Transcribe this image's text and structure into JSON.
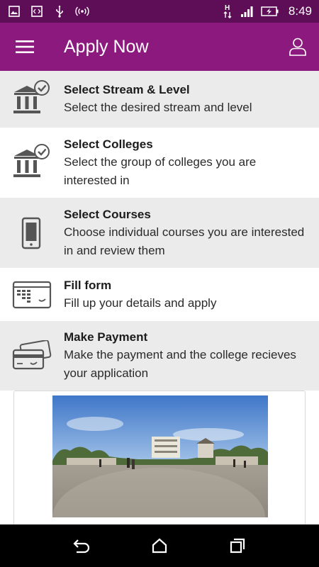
{
  "status_bar": {
    "time": "8:49",
    "icons": [
      "image-icon",
      "code-icon",
      "usb-icon",
      "hotspot-icon",
      "h-data-icon",
      "signal-icon",
      "battery-charging-icon"
    ]
  },
  "app_bar": {
    "title": "Apply Now",
    "menu_icon": "hamburger-menu-icon",
    "profile_icon": "user-profile-icon",
    "background": "#8c1a7e",
    "status_background": "#5e0d57"
  },
  "steps": [
    {
      "title": "Select Stream & Level",
      "description": "Select the desired stream and level",
      "icon": "institution-check-icon"
    },
    {
      "title": "Select Colleges",
      "description": "Select the group of colleges you are interested in",
      "icon": "institution-check-icon"
    },
    {
      "title": "Select Courses",
      "description": "Choose individual courses you are interested in and review them",
      "icon": "mobile-icon"
    },
    {
      "title": "Fill form",
      "description": "Fill up your details and apply",
      "icon": "form-window-icon"
    },
    {
      "title": "Make Payment",
      "description": "Make the payment and the college recieves your application",
      "icon": "credit-card-icon"
    }
  ],
  "navigation": {
    "icons": [
      "back-icon",
      "home-icon",
      "recent-apps-icon"
    ]
  }
}
